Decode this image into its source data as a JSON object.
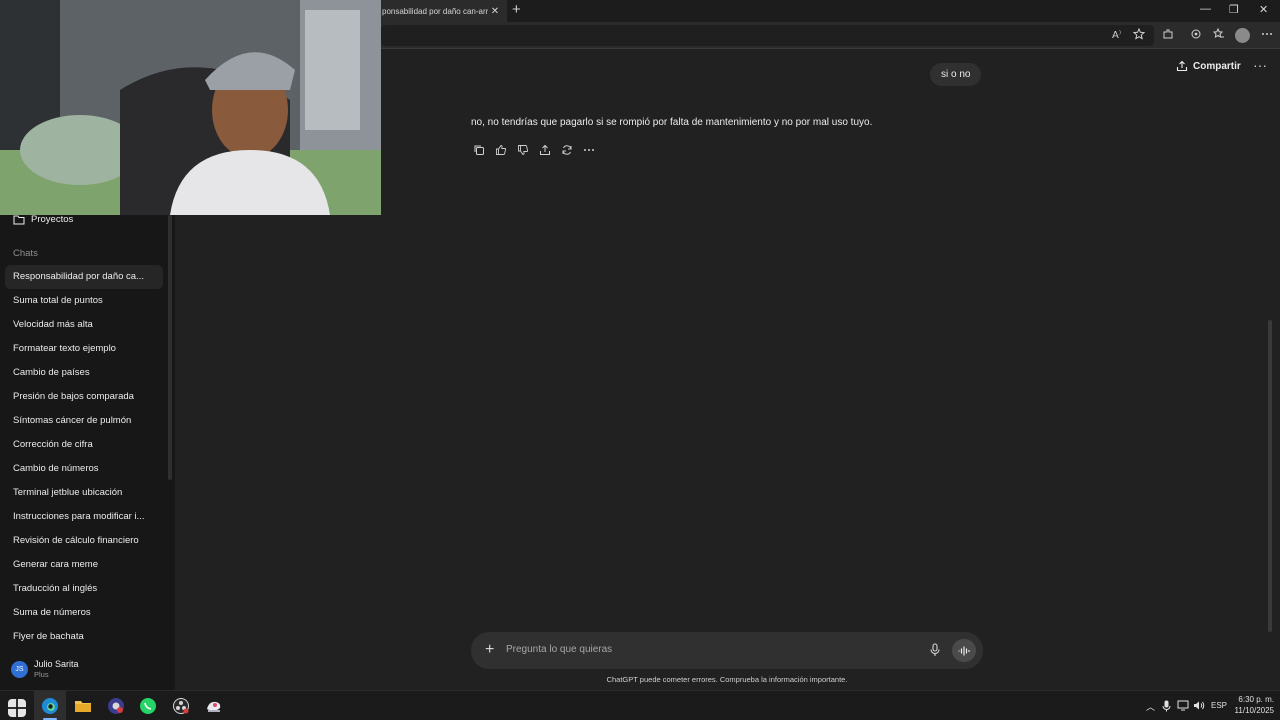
{
  "browser": {
    "tab_title": "ponsabilidad por daño can-arr",
    "tab_close": "✕",
    "new_tab": "+",
    "win_min": "—",
    "win_max": "❐",
    "win_close": "✕"
  },
  "sidebar": {
    "projects_label": "Proyectos",
    "chats_label": "Chats",
    "chats": [
      "Responsabilidad por daño ca...",
      "Suma total de puntos",
      "Velocidad más alta",
      "Formatear texto ejemplo",
      "Cambio de países",
      "Presión de bajos comparada",
      "Síntomas cáncer de pulmón",
      "Corrección de cifra",
      "Cambio de números",
      "Terminal jetblue ubicación",
      "Instrucciones para modificar i...",
      "Revisión de cálculo financiero",
      "Generar cara meme",
      "Traducción al inglés",
      "Suma de números",
      "Flyer de bachata"
    ],
    "user": {
      "initials": "JS",
      "name": "Julio Sarita",
      "plan": "Plus",
      "avatar_color": "#2f6fd6"
    }
  },
  "header": {
    "share_label": "Compartir",
    "more": "···"
  },
  "conversation": {
    "user_message": "si o no",
    "assistant_message": "no, no tendrías que pagarlo si se rompió por falta de mantenimiento y no por mal uso tuyo."
  },
  "composer": {
    "placeholder": "Pregunta lo que quieras",
    "disclaimer": "ChatGPT puede cometer errores. Comprueba la información importante."
  },
  "taskbar": {
    "language": "ESP",
    "time": "6:30 p. m.",
    "date": "11/10/2025",
    "tray_chevron": "︿"
  },
  "colors": {
    "background": "#212121",
    "sidebar": "#171717",
    "bubble": "#303030",
    "accent": "#2f6fd6"
  }
}
